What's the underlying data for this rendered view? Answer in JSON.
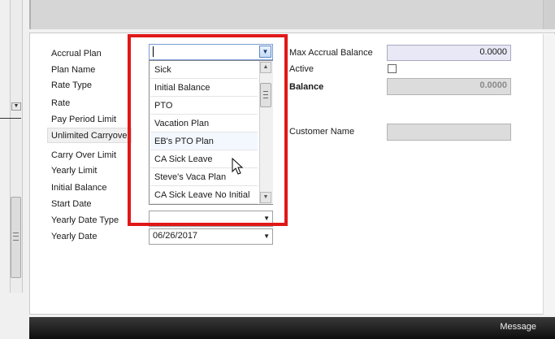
{
  "form": {
    "labels": {
      "accrual_plan": "Accrual Plan",
      "plan_name": "Plan Name",
      "rate_type": "Rate Type",
      "rate": "Rate",
      "pay_period_limit": "Pay Period Limit",
      "unlimited_carryover": "Unlimited Carryover",
      "carry_over_limit": "Carry Over Limit",
      "yearly_limit": "Yearly Limit",
      "initial_balance": "Initial Balance",
      "start_date": "Start Date",
      "yearly_date_type": "Yearly Date Type",
      "yearly_date": "Yearly Date",
      "max_accrual_balance": "Max Accrual Balance",
      "active": "Active",
      "balance": "Balance",
      "customer_name": "Customer Name"
    },
    "values": {
      "accrual_plan": "",
      "max_accrual_balance": "0.0000",
      "balance": "0.0000",
      "customer_name": "",
      "active": false,
      "yearly_date_type": "",
      "yearly_date": "06/26/2017"
    }
  },
  "dropdown": {
    "items": [
      "Sick",
      "Initial Balance",
      "PTO",
      "Vacation Plan",
      "EB's PTO Plan",
      "CA Sick Leave",
      "Steve's Vaca Plan",
      "CA Sick Leave No Initial"
    ],
    "hovered_index": 4
  },
  "status_bar": {
    "message": "Message"
  },
  "colors": {
    "highlight": "#e01818",
    "field_bg": "#e8e8f6",
    "status_bar": "#1a1a1a"
  }
}
